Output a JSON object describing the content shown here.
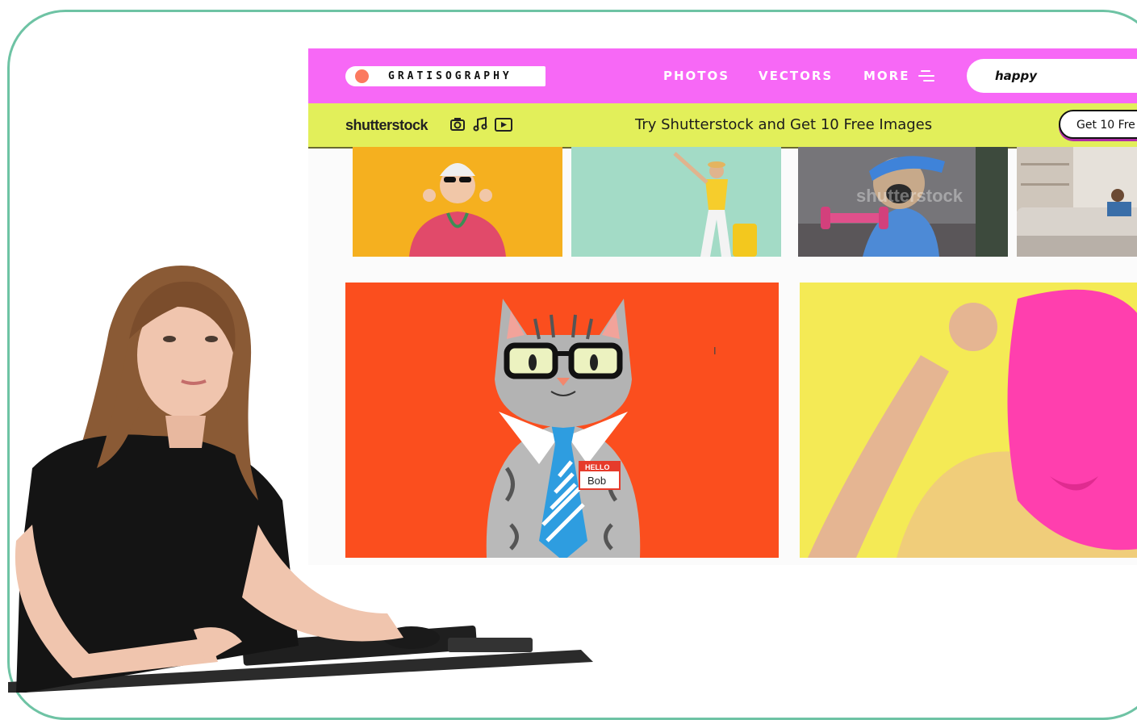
{
  "site": {
    "logo": "GRATISOGRAPHY",
    "nav": [
      {
        "label": "PHOTOS"
      },
      {
        "label": "VECTORS"
      },
      {
        "label": "MORE"
      }
    ],
    "search": {
      "value": "happy"
    }
  },
  "promo": {
    "brand": "shutterstock",
    "text": "Try Shutterstock and Get 10 Free Images",
    "button": "Get 10 Fre"
  },
  "watermark": "shutterstock",
  "cat": {
    "badge_top": "HELLO",
    "badge_name": "Bob"
  },
  "colors": {
    "nav_pink": "#f768f6",
    "promo_yellow": "#e2ef5a",
    "cat_bg": "#fb4e1e",
    "yellow_bg": "#f4ea55",
    "frame_green": "#6ec3a4"
  },
  "icons": [
    "camera-icon",
    "music-icon",
    "video-icon",
    "menu-icon"
  ]
}
